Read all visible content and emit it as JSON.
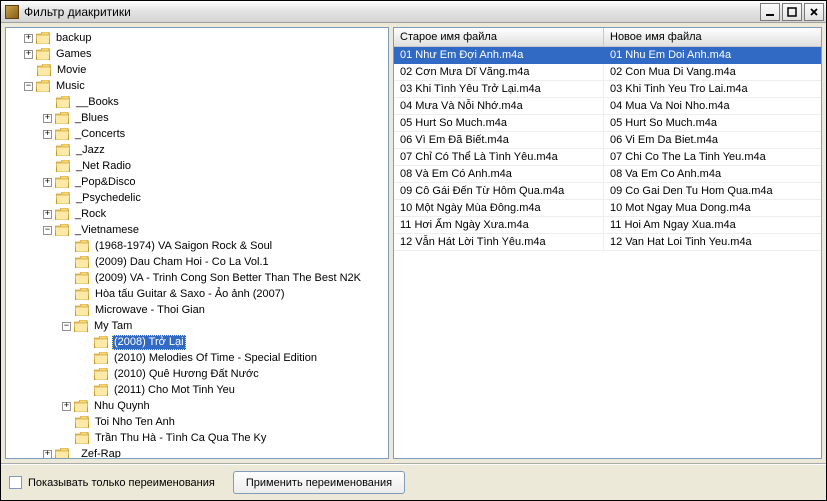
{
  "window": {
    "title": "Фильтр диакритики"
  },
  "tree": [
    {
      "depth": 0,
      "exp": "+",
      "label": "backup"
    },
    {
      "depth": 0,
      "exp": "+",
      "label": "Games"
    },
    {
      "depth": 0,
      "exp": "",
      "label": "Movie"
    },
    {
      "depth": 0,
      "exp": "-",
      "label": "Music"
    },
    {
      "depth": 1,
      "exp": "",
      "label": "__Books"
    },
    {
      "depth": 1,
      "exp": "+",
      "label": "_Blues"
    },
    {
      "depth": 1,
      "exp": "+",
      "label": "_Concerts"
    },
    {
      "depth": 1,
      "exp": "",
      "label": "_Jazz"
    },
    {
      "depth": 1,
      "exp": "",
      "label": "_Net Radio"
    },
    {
      "depth": 1,
      "exp": "+",
      "label": "_Pop&Disco"
    },
    {
      "depth": 1,
      "exp": "",
      "label": "_Psychedelic"
    },
    {
      "depth": 1,
      "exp": "+",
      "label": "_Rock"
    },
    {
      "depth": 1,
      "exp": "-",
      "label": "_Vietnamese"
    },
    {
      "depth": 2,
      "exp": "",
      "label": "(1968-1974) VA Saigon Rock & Soul"
    },
    {
      "depth": 2,
      "exp": "",
      "label": "(2009) Dau Cham Hoi - Co La Vol.1"
    },
    {
      "depth": 2,
      "exp": "",
      "label": "(2009) VA - Trinh Cong Son Better Than The Best N2K"
    },
    {
      "depth": 2,
      "exp": "",
      "label": "Hòa tấu Guitar & Saxo - Ảo ảnh (2007)"
    },
    {
      "depth": 2,
      "exp": "",
      "label": "Microwave - Thoi Gian"
    },
    {
      "depth": 2,
      "exp": "-",
      "label": "My Tam"
    },
    {
      "depth": 3,
      "exp": "",
      "label": "(2008) Trở Lại",
      "selected": true
    },
    {
      "depth": 3,
      "exp": "",
      "label": "(2010) Melodies Of Time - Special Edition"
    },
    {
      "depth": 3,
      "exp": "",
      "label": "(2010) Quê Hương Đất Nước"
    },
    {
      "depth": 3,
      "exp": "",
      "label": "(2011) Cho Mot Tinh Yeu"
    },
    {
      "depth": 2,
      "exp": "+",
      "label": "Nhu Quynh"
    },
    {
      "depth": 2,
      "exp": "",
      "label": "Toi Nho Ten Anh"
    },
    {
      "depth": 2,
      "exp": "",
      "label": "Trần Thu Hà - Tình Ca Qua The Ky"
    },
    {
      "depth": 1,
      "exp": "+",
      "label": "_Zef-Rap"
    }
  ],
  "table": {
    "columns": [
      "Старое имя файла",
      "Новое имя файла"
    ],
    "rows": [
      {
        "old": "01 Như Em Đợi Anh.m4a",
        "new": "01 Nhu Em Doi Anh.m4a",
        "selected": true
      },
      {
        "old": "02 Cơn Mưa Dĩ Vãng.m4a",
        "new": "02 Con Mua Di Vang.m4a"
      },
      {
        "old": "03 Khi Tình Yêu Trở Lại.m4a",
        "new": "03 Khi Tinh Yeu Tro Lai.m4a"
      },
      {
        "old": "04 Mưa Và Nỗi Nhớ.m4a",
        "new": "04 Mua Va Noi Nho.m4a"
      },
      {
        "old": "05 Hurt So Much.m4a",
        "new": "05 Hurt So Much.m4a"
      },
      {
        "old": "06 Vì Em Đã Biết.m4a",
        "new": "06 Vi Em Da Biet.m4a"
      },
      {
        "old": "07 Chỉ Có Thể Là Tình Yêu.m4a",
        "new": "07 Chi Co The La Tinh Yeu.m4a"
      },
      {
        "old": "08 Và Em Có Anh.m4a",
        "new": "08 Va Em Co Anh.m4a"
      },
      {
        "old": "09 Cô Gái Đến Từ Hôm Qua.m4a",
        "new": "09 Co Gai Den Tu Hom Qua.m4a"
      },
      {
        "old": "10 Một Ngày Mùa Đông.m4a",
        "new": "10 Mot Ngay Mua Dong.m4a"
      },
      {
        "old": "11 Hơi Ấm Ngày Xưa.m4a",
        "new": "11 Hoi Am Ngay Xua.m4a"
      },
      {
        "old": "12 Vẫn Hát Lời Tình Yêu.m4a",
        "new": "12 Van Hat Loi Tinh Yeu.m4a"
      }
    ]
  },
  "bottom": {
    "checkbox_label": "Показывать только переименования",
    "apply_button": "Применить переименования"
  }
}
